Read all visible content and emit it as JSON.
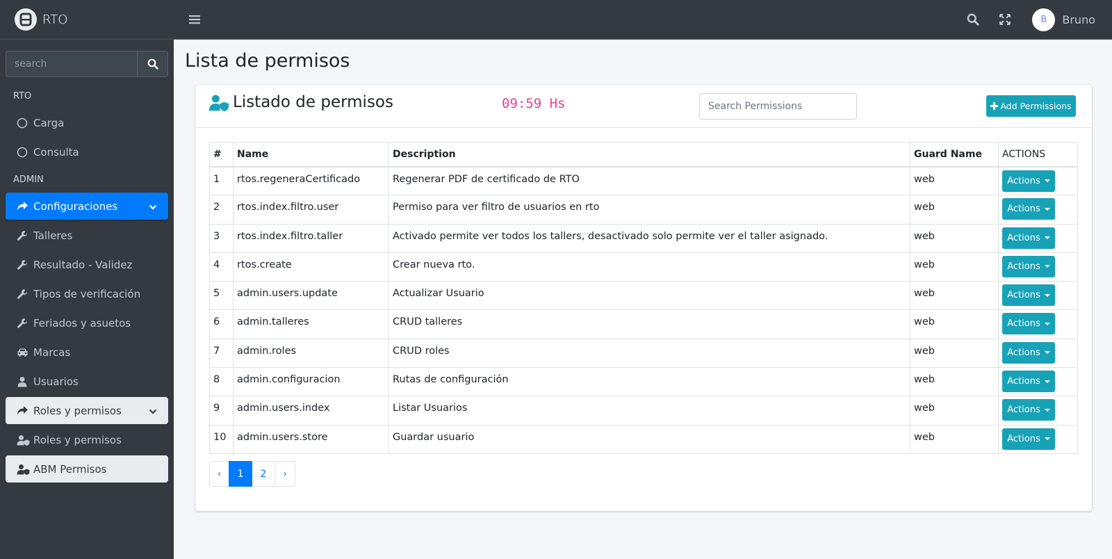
{
  "brand": {
    "name": "RTO"
  },
  "sidebar": {
    "search_placeholder": "search",
    "sections": [
      {
        "header": "RTO",
        "items": [
          {
            "label": "Carga"
          },
          {
            "label": "Consulta"
          }
        ]
      },
      {
        "header": "ADMIN",
        "items": [
          {
            "label": "Configuraciones"
          },
          {
            "label": "Talleres"
          },
          {
            "label": "Resultado - Validez"
          },
          {
            "label": "Tipos de verificación"
          },
          {
            "label": "Feriados y asuetos"
          },
          {
            "label": "Marcas"
          },
          {
            "label": "Usuarios"
          },
          {
            "label": "Roles y permisos"
          },
          {
            "label": "Roles y permisos"
          },
          {
            "label": "ABM Permisos"
          }
        ]
      }
    ]
  },
  "topbar": {
    "user_initial": "B",
    "user_name": "Bruno"
  },
  "page": {
    "title": "Lista de permisos"
  },
  "card": {
    "title": "Listado de permisos",
    "clock": "09:59 Hs",
    "search_placeholder": "Search Permissions",
    "add_label": "Add Permissions"
  },
  "table": {
    "headers": [
      "#",
      "Name",
      "Description",
      "Guard Name",
      "ACTIONS"
    ],
    "action_label": "Actions",
    "rows": [
      {
        "num": "1",
        "name": "rtos.regeneraCertificado",
        "description": "Regenerar PDF de certificado de RTO",
        "guard": "web"
      },
      {
        "num": "2",
        "name": "rtos.index.filtro.user",
        "description": "Permiso para ver filtro de usuarios en rto",
        "guard": "web"
      },
      {
        "num": "3",
        "name": "rtos.index.filtro.taller",
        "description": "Activado permite ver todos los tallers, desactivado solo permite ver el taller asignado.",
        "guard": "web"
      },
      {
        "num": "4",
        "name": "rtos.create",
        "description": "Crear nueva rto.",
        "guard": "web"
      },
      {
        "num": "5",
        "name": "admin.users.update",
        "description": "Actualizar Usuario",
        "guard": "web"
      },
      {
        "num": "6",
        "name": "admin.talleres",
        "description": "CRUD talleres",
        "guard": "web"
      },
      {
        "num": "7",
        "name": "admin.roles",
        "description": "CRUD roles",
        "guard": "web"
      },
      {
        "num": "8",
        "name": "admin.configuracion",
        "description": "Rutas de configuración",
        "guard": "web"
      },
      {
        "num": "9",
        "name": "admin.users.index",
        "description": "Listar Usuarios",
        "guard": "web"
      },
      {
        "num": "10",
        "name": "admin.users.store",
        "description": "Guardar usuario",
        "guard": "web"
      }
    ]
  },
  "pagination": {
    "prev": "‹",
    "pages": [
      "1",
      "2"
    ],
    "next": "›",
    "active": "1"
  },
  "colors": {
    "sidebar_bg": "#343a40",
    "primary": "#007bff",
    "info": "#17a2b8",
    "clock": "#e83e8c"
  }
}
